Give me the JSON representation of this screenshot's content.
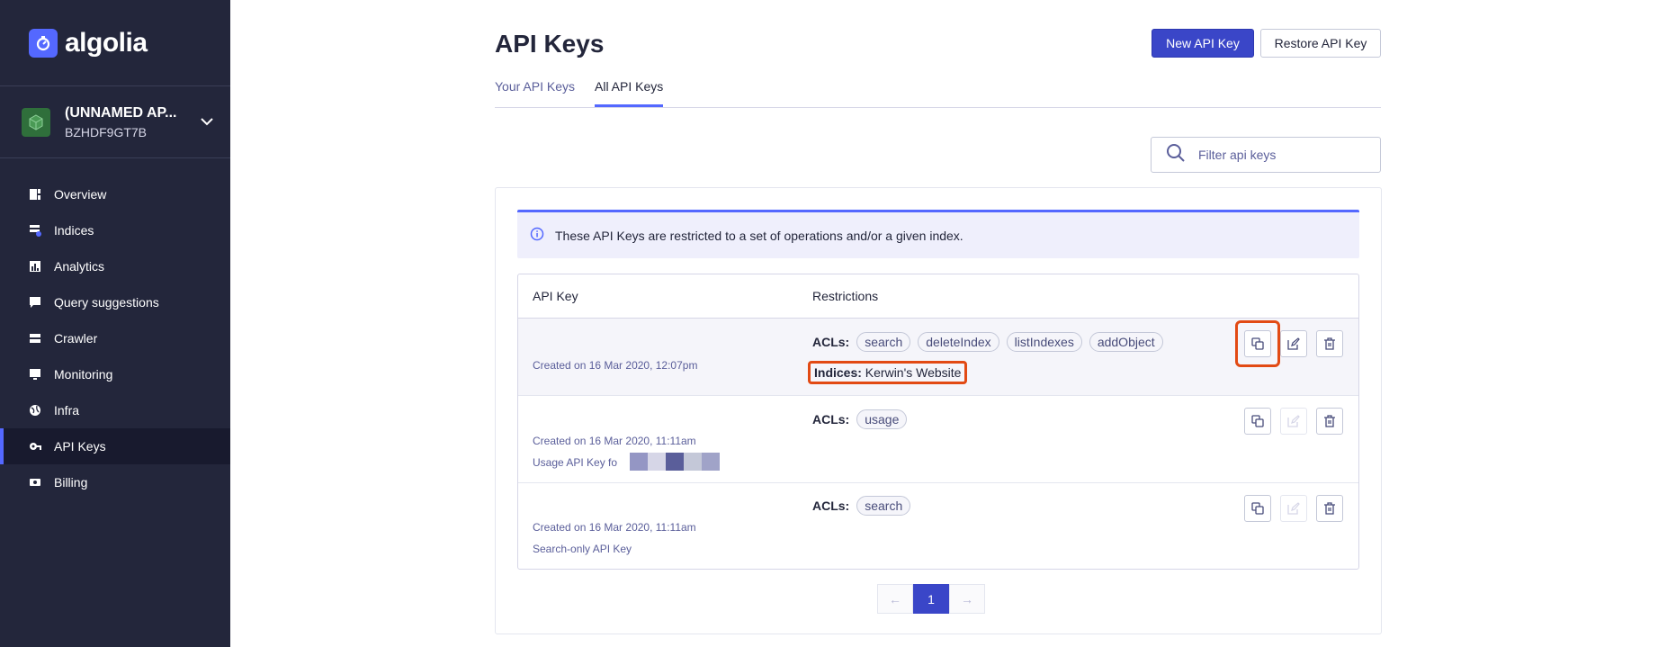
{
  "brand": {
    "name": "algolia"
  },
  "app": {
    "name": "(UNNAMED AP...",
    "id": "BZHDF9GT7B"
  },
  "nav": [
    {
      "label": "Overview",
      "icon": "overview-icon"
    },
    {
      "label": "Indices",
      "icon": "indices-icon"
    },
    {
      "label": "Analytics",
      "icon": "analytics-icon"
    },
    {
      "label": "Query suggestions",
      "icon": "query-suggestions-icon"
    },
    {
      "label": "Crawler",
      "icon": "crawler-icon"
    },
    {
      "label": "Monitoring",
      "icon": "monitoring-icon"
    },
    {
      "label": "Infra",
      "icon": "globe-icon"
    },
    {
      "label": "API Keys",
      "icon": "key-icon",
      "active": true
    },
    {
      "label": "Billing",
      "icon": "billing-icon"
    }
  ],
  "page": {
    "title": "API Keys",
    "new_key_label": "New API Key",
    "restore_key_label": "Restore API Key",
    "tabs": [
      "Your API Keys",
      "All API Keys"
    ],
    "active_tab": "All API Keys",
    "filter_placeholder": "Filter api keys"
  },
  "notice": "These API Keys are restricted to a set of operations and/or a given index.",
  "table": {
    "headers": [
      "API Key",
      "Restrictions"
    ],
    "acl_label": "ACLs:",
    "indices_label": "Indices:",
    "rows": [
      {
        "created": "Created on 16 Mar 2020, 12:07pm",
        "description": "",
        "acls": [
          "search",
          "deleteIndex",
          "listIndexes",
          "addObject"
        ],
        "indices": "Kerwin's Website",
        "edit_enabled": true
      },
      {
        "created": "Created on 16 Mar 2020, 11:11am",
        "description": "Usage API Key fo",
        "acls": [
          "usage"
        ],
        "indices": "",
        "edit_enabled": false
      },
      {
        "created": "Created on 16 Mar 2020, 11:11am",
        "description": "Search-only API Key",
        "acls": [
          "search"
        ],
        "indices": "",
        "edit_enabled": false
      }
    ]
  },
  "pagination": {
    "prev": "←",
    "current": "1",
    "next": "→"
  },
  "colors": {
    "sidebar": "#23263b",
    "accent": "#5468ff",
    "primary_button": "#3a46c8",
    "highlight": "#e24a14"
  }
}
